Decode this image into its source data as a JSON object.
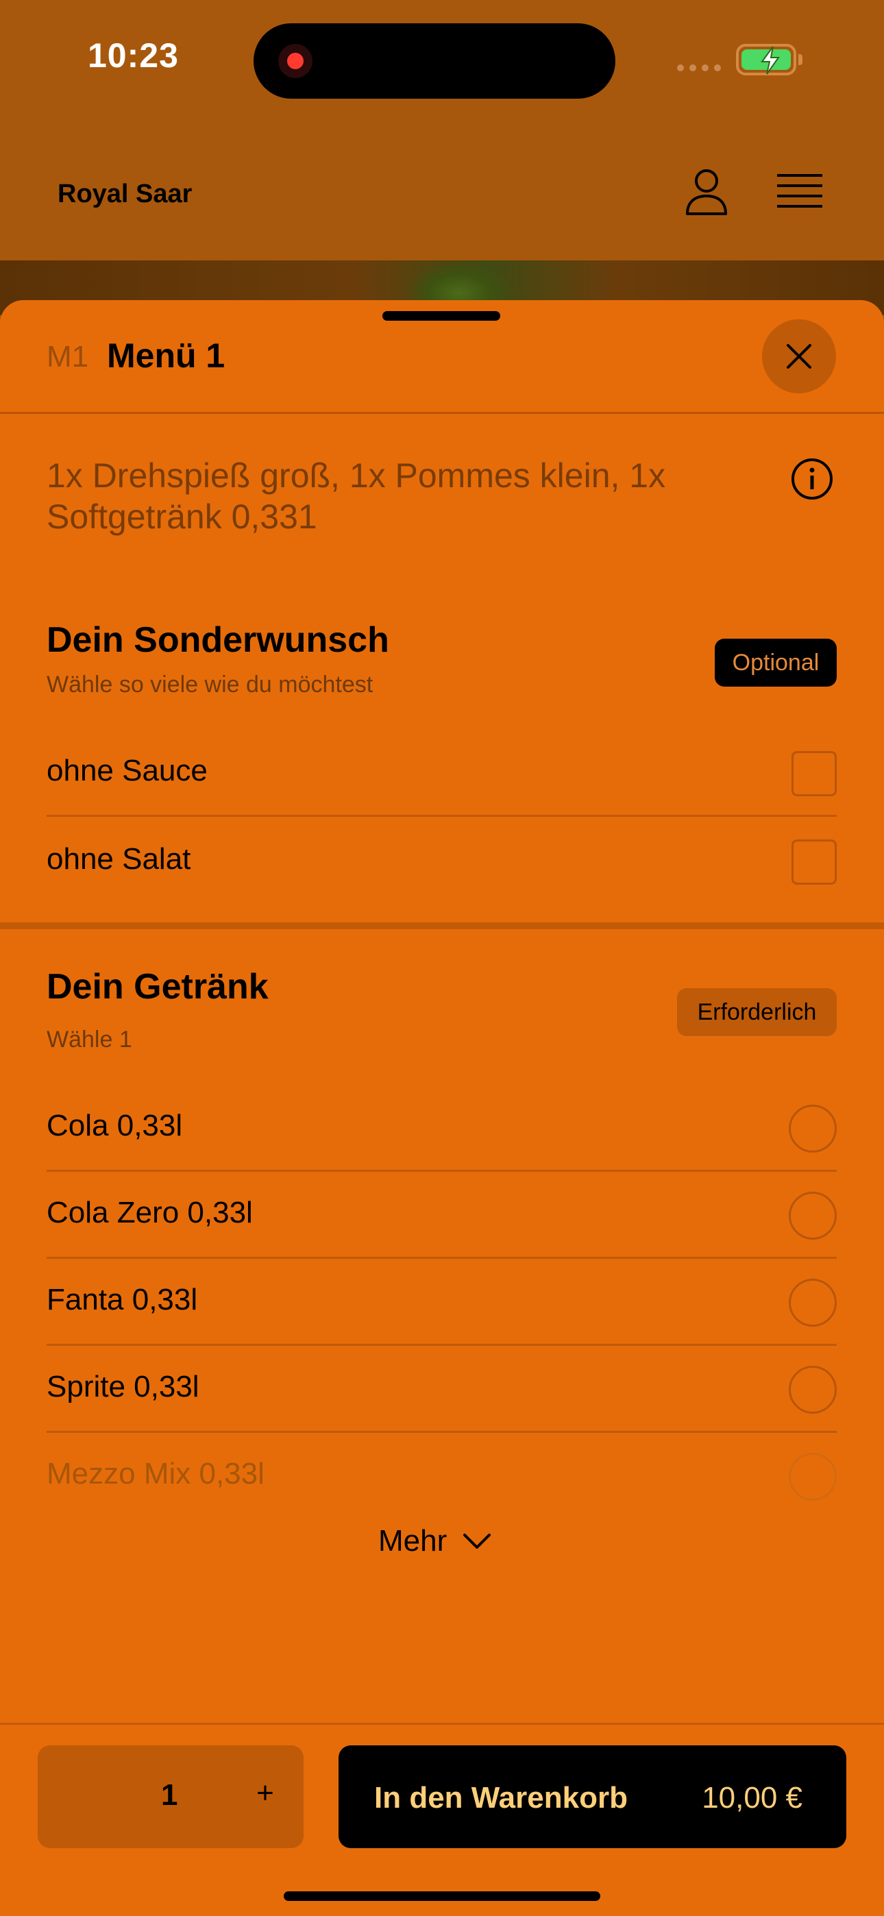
{
  "status_bar": {
    "time": "10:23"
  },
  "header": {
    "brand": "Royal Saar"
  },
  "sheet": {
    "code": "M1",
    "title": "Menü 1",
    "description": "1x Drehspieß groß, 1x Pommes klein, 1x Softgetränk 0,331"
  },
  "sections": [
    {
      "title": "Dein Sonderwunsch",
      "subtitle": "Wähle so viele wie du möchtest",
      "badge": "Optional",
      "options": [
        "ohne Sauce",
        "ohne Salat"
      ]
    },
    {
      "title": "Dein Getränk",
      "subtitle": "Wähle 1",
      "badge": "Erforderlich",
      "options": [
        "Cola 0,33l",
        "Cola Zero 0,33l",
        "Fanta 0,33l",
        "Sprite 0,33l",
        "Mezzo Mix 0,33l"
      ]
    }
  ],
  "more_label": "Mehr",
  "footer": {
    "quantity": "1",
    "plus": "+",
    "cart_label": "In den Warenkorb",
    "price": "10,00 €"
  },
  "colors": {
    "sheet": "#e66c0a",
    "header": "#a8580c",
    "cart_text": "#ffcf7a",
    "battery": "#4cd964"
  }
}
